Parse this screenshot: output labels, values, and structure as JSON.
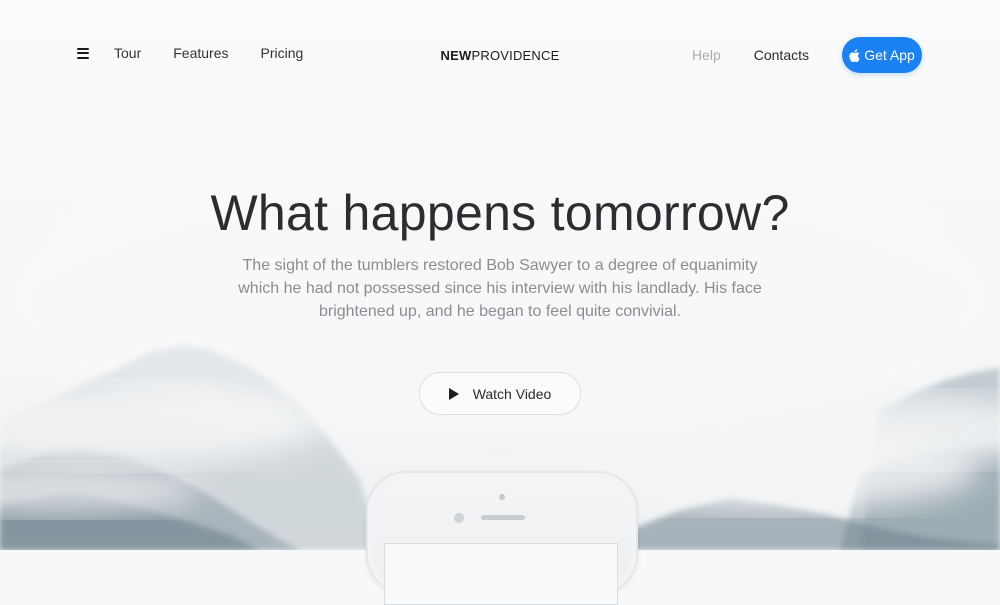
{
  "nav": {
    "left_links": [
      {
        "label": "Tour",
        "name": "nav-tour-link"
      },
      {
        "label": "Features",
        "name": "nav-features-link"
      },
      {
        "label": "Pricing",
        "name": "nav-pricing-link"
      }
    ],
    "brand": {
      "bold": "NEW",
      "light": "PROVIDENCE"
    },
    "help_label": "Help",
    "contacts_label": "Contacts",
    "get_app_label": "Get App",
    "menu_icon": "hamburger-menu-icon",
    "apple_icon": "apple-icon"
  },
  "hero": {
    "title": "What happens tomorrow?",
    "subtitle": "The sight of the tumblers restored Bob Sawyer to a degree of equanimity which he had not possessed since his interview with his landlady. His face brightened up, and he began to feel quite convivial.",
    "watch_label": "Watch Video",
    "play_icon": "play-icon"
  },
  "colors": {
    "accent": "#1a82f5",
    "help_text": "#a9acb1",
    "subtitle_text": "#8a8d92",
    "title_text": "#2c2d30"
  }
}
